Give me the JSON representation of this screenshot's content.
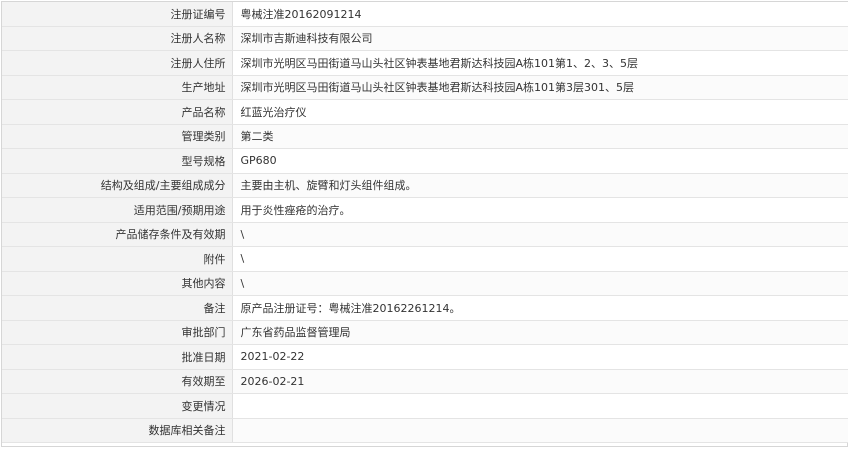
{
  "rows": [
    {
      "label": "注册证编号",
      "value": "粤械注准20162091214"
    },
    {
      "label": "注册人名称",
      "value": "深圳市吉斯迪科技有限公司"
    },
    {
      "label": "注册人住所",
      "value": "深圳市光明区马田街道马山头社区钟表基地君斯达科技园A栋101第1、2、3、5层"
    },
    {
      "label": "生产地址",
      "value": "深圳市光明区马田街道马山头社区钟表基地君斯达科技园A栋101第3层301、5层"
    },
    {
      "label": "产品名称",
      "value": "红蓝光治疗仪"
    },
    {
      "label": "管理类别",
      "value": "第二类"
    },
    {
      "label": "型号规格",
      "value": "GP680"
    },
    {
      "label": "结构及组成/主要组成成分",
      "value": "主要由主机、旋臂和灯头组件组成。"
    },
    {
      "label": "适用范围/预期用途",
      "value": "用于炎性痤疮的治疗。"
    },
    {
      "label": "产品储存条件及有效期",
      "value": "\\"
    },
    {
      "label": "附件",
      "value": "\\"
    },
    {
      "label": "其他内容",
      "value": "\\"
    },
    {
      "label": "备注",
      "value": "原产品注册证号：粤械注准20162261214。"
    },
    {
      "label": "审批部门",
      "value": "广东省药品监督管理局"
    },
    {
      "label": "批准日期",
      "value": "2021-02-22"
    },
    {
      "label": "有效期至",
      "value": "2026-02-21"
    },
    {
      "label": "变更情况",
      "value": ""
    },
    {
      "label": "数据库相关备注",
      "value": ""
    }
  ]
}
